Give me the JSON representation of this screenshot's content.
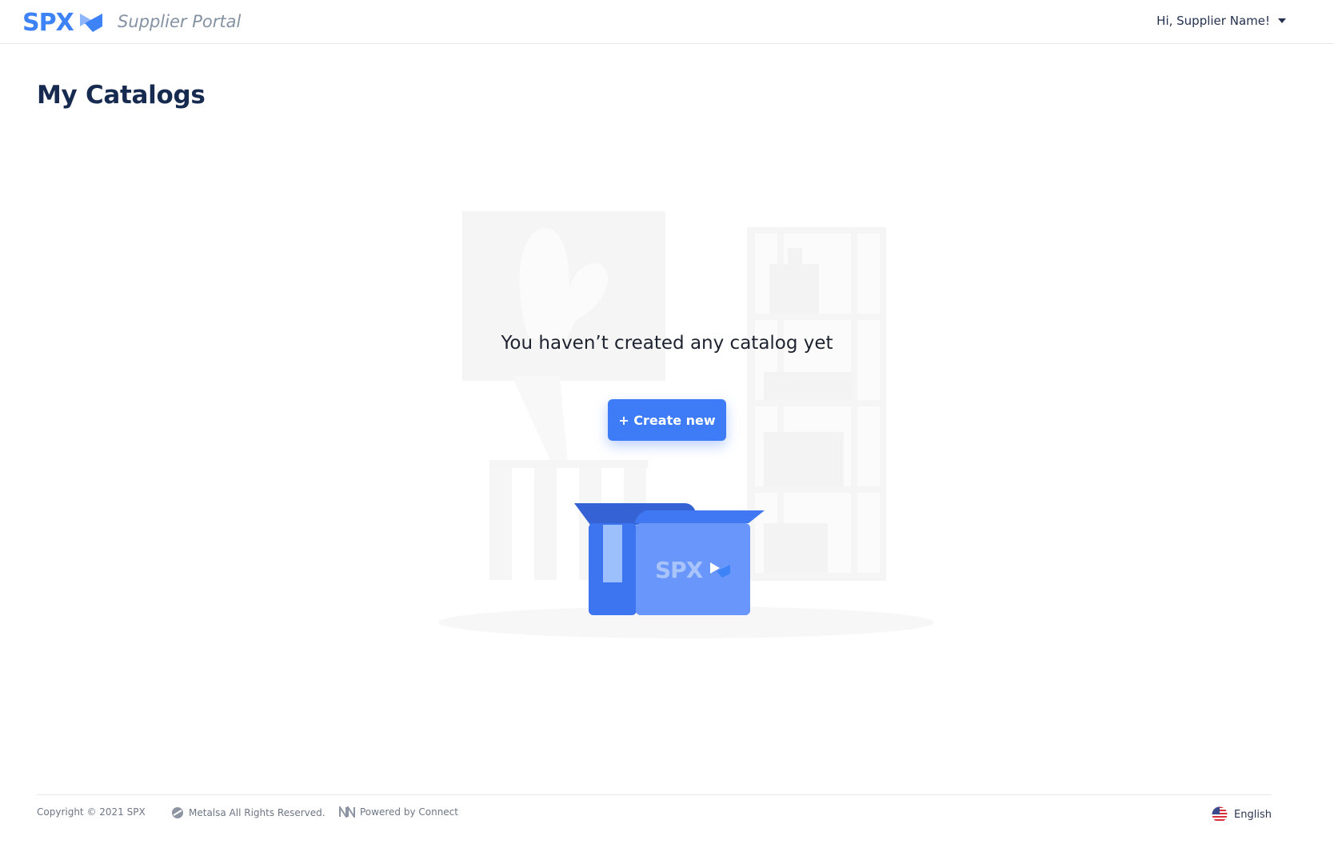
{
  "header": {
    "logo_text": "SPX",
    "portal_name": "Supplier Portal",
    "user_greeting": "Hi, Supplier Name!"
  },
  "main": {
    "title": "My Catalogs",
    "empty_message": "You haven’t created any catalog yet",
    "create_button": "+ Create new",
    "box_brand": "SPX"
  },
  "footer": {
    "copyright": "Copyright © 2021 SPX",
    "rights": "Metalsa All Rights Reserved.",
    "powered": "Powered by Connect",
    "language": "English"
  },
  "colors": {
    "brand_blue": "#3e82f7",
    "button_blue": "#3e7bf6",
    "title_navy": "#172a4f"
  },
  "icons": [
    "spx-logo-icon",
    "chevron-down-icon",
    "metalsa-icon",
    "connect-icon",
    "us-flag-icon"
  ]
}
